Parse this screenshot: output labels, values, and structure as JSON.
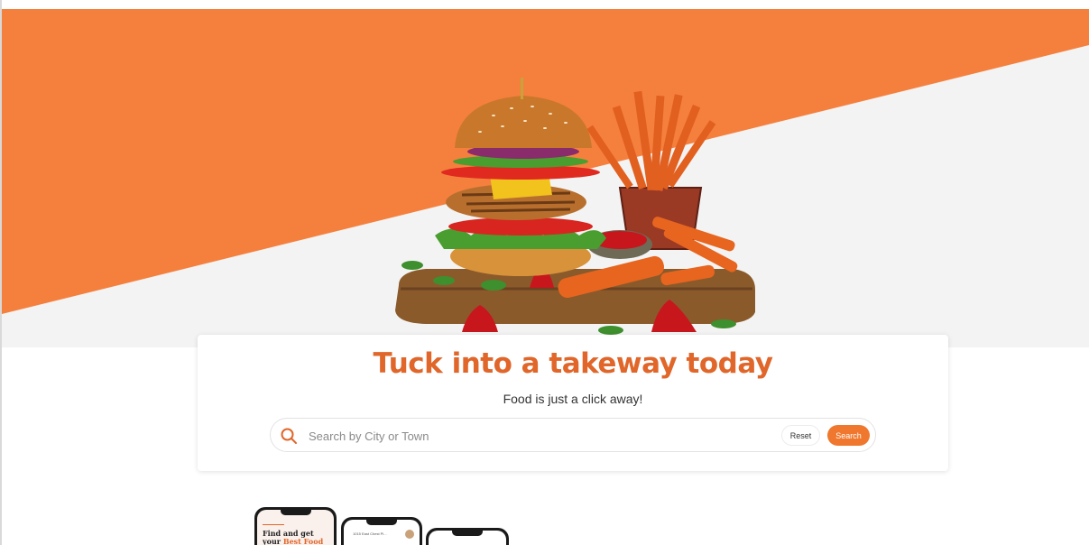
{
  "colors": {
    "brand_orange": "#f5803e",
    "headline_orange": "#e0662a",
    "button_orange": "#f0782e",
    "hero_grey": "#f3f3f3"
  },
  "hero": {
    "image": "burger-and-sweet-potato-fries-illustration"
  },
  "search_card": {
    "headline": "Tuck into a takeway today",
    "subline": "Food is just a click away!",
    "search": {
      "icon": "search-icon",
      "placeholder": "Search by City or Town",
      "value": ""
    },
    "reset_label": "Reset",
    "search_label": "Search"
  },
  "phones": {
    "phone1": {
      "title_line1": "Find and get",
      "title_line2_prefix": "your",
      "title_line2_accent": "Best Food"
    },
    "phone2": {
      "address": "1015 East Chest Pl..."
    }
  }
}
